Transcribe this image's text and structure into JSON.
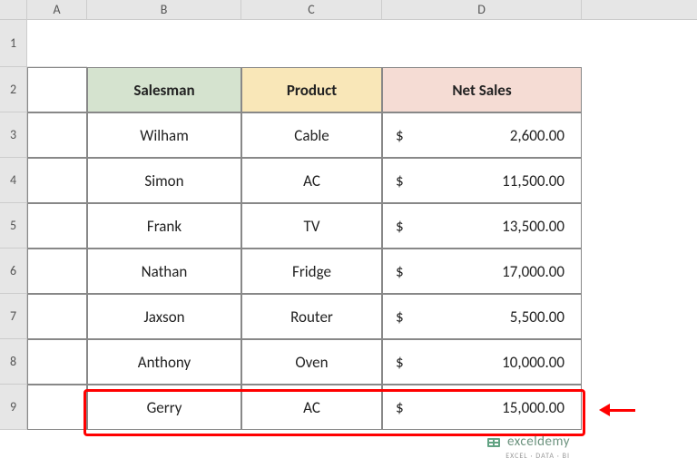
{
  "columns": {
    "A": "A",
    "B": "B",
    "C": "C",
    "D": "D"
  },
  "row_numbers": [
    "1",
    "2",
    "3",
    "4",
    "5",
    "6",
    "7",
    "8",
    "9"
  ],
  "headers": {
    "salesman": "Salesman",
    "product": "Product",
    "netsales": "Net Sales"
  },
  "rows": [
    {
      "salesman": "Wilham",
      "product": "Cable",
      "currency": "$",
      "amount": "2,600.00"
    },
    {
      "salesman": "Simon",
      "product": "AC",
      "currency": "$",
      "amount": "11,500.00"
    },
    {
      "salesman": "Frank",
      "product": "TV",
      "currency": "$",
      "amount": "13,500.00"
    },
    {
      "salesman": "Nathan",
      "product": "Fridge",
      "currency": "$",
      "amount": "17,000.00"
    },
    {
      "salesman": "Jaxson",
      "product": "Router",
      "currency": "$",
      "amount": "5,500.00"
    },
    {
      "salesman": "Anthony",
      "product": "Oven",
      "currency": "$",
      "amount": "10,000.00"
    },
    {
      "salesman": "Gerry",
      "product": "AC",
      "currency": "$",
      "amount": "15,000.00"
    }
  ],
  "watermark": {
    "brand": "exceldemy",
    "tagline": "EXCEL · DATA · BI"
  }
}
